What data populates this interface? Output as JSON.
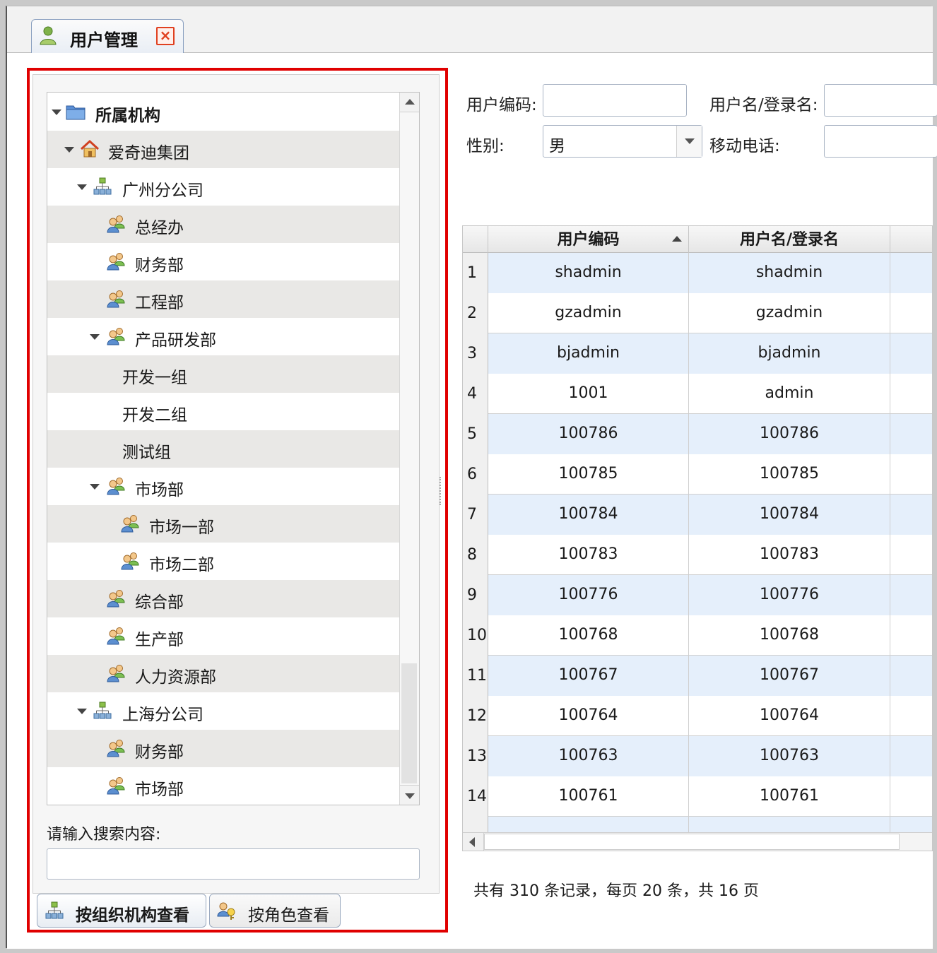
{
  "tab": {
    "title": "用户管理",
    "close_label": "×"
  },
  "tree": {
    "items": [
      {
        "label": "所属机构",
        "level": 0,
        "expanded": true,
        "icon": "folder-icon"
      },
      {
        "label": "爱奇迪集团",
        "level": 1,
        "expanded": true,
        "icon": "home-icon"
      },
      {
        "label": "广州分公司",
        "level": 2,
        "expanded": true,
        "icon": "org-icon"
      },
      {
        "label": "总经办",
        "level": 3,
        "icon": "group-icon"
      },
      {
        "label": "财务部",
        "level": 3,
        "icon": "group-icon"
      },
      {
        "label": "工程部",
        "level": 3,
        "icon": "group-icon"
      },
      {
        "label": "产品研发部",
        "level": 3,
        "expanded": true,
        "icon": "group-icon"
      },
      {
        "label": "开发一组",
        "level": 4,
        "icon": ""
      },
      {
        "label": "开发二组",
        "level": 4,
        "icon": ""
      },
      {
        "label": "测试组",
        "level": 4,
        "icon": ""
      },
      {
        "label": "市场部",
        "level": 3,
        "expanded": true,
        "icon": "group-icon"
      },
      {
        "label": "市场一部",
        "level": 4,
        "icon": "group-icon"
      },
      {
        "label": "市场二部",
        "level": 4,
        "icon": "group-icon"
      },
      {
        "label": "综合部",
        "level": 3,
        "icon": "group-icon"
      },
      {
        "label": "生产部",
        "level": 3,
        "icon": "group-icon"
      },
      {
        "label": "人力资源部",
        "level": 3,
        "icon": "group-icon"
      },
      {
        "label": "上海分公司",
        "level": 2,
        "expanded": true,
        "icon": "org-icon"
      },
      {
        "label": "财务部",
        "level": 3,
        "icon": "group-icon"
      },
      {
        "label": "市场部",
        "level": 3,
        "icon": "group-icon"
      }
    ]
  },
  "search": {
    "label": "请输入搜索内容:",
    "value": ""
  },
  "bottom_tabs": [
    {
      "label": "按组织机构查看",
      "active": true
    },
    {
      "label": "按角色查看",
      "active": false
    }
  ],
  "filters": {
    "user_code_label": "用户编码:",
    "user_code_value": "",
    "username_label": "用户名/登录名:",
    "username_value": "",
    "gender_label": "性别:",
    "gender_value": "男",
    "phone_label": "移动电话:",
    "phone_value": ""
  },
  "grid": {
    "columns": [
      "用户编码",
      "用户名/登录名"
    ],
    "rows": [
      [
        "1",
        "shadmin",
        "shadmin"
      ],
      [
        "2",
        "gzadmin",
        "gzadmin"
      ],
      [
        "3",
        "bjadmin",
        "bjadmin"
      ],
      [
        "4",
        "1001",
        "admin"
      ],
      [
        "5",
        "100786",
        "100786"
      ],
      [
        "6",
        "100785",
        "100785"
      ],
      [
        "7",
        "100784",
        "100784"
      ],
      [
        "8",
        "100783",
        "100783"
      ],
      [
        "9",
        "100776",
        "100776"
      ],
      [
        "10",
        "100768",
        "100768"
      ],
      [
        "11",
        "100767",
        "100767"
      ],
      [
        "12",
        "100764",
        "100764"
      ],
      [
        "13",
        "100763",
        "100763"
      ],
      [
        "14",
        "100761",
        "100761"
      ]
    ]
  },
  "pager": {
    "text": "共有 310 条记录，每页 20 条，共 16 页"
  },
  "colors": {
    "highlight": "#e00000",
    "row_blue": "#e5effb",
    "row_alt": "#e9e8e6"
  }
}
